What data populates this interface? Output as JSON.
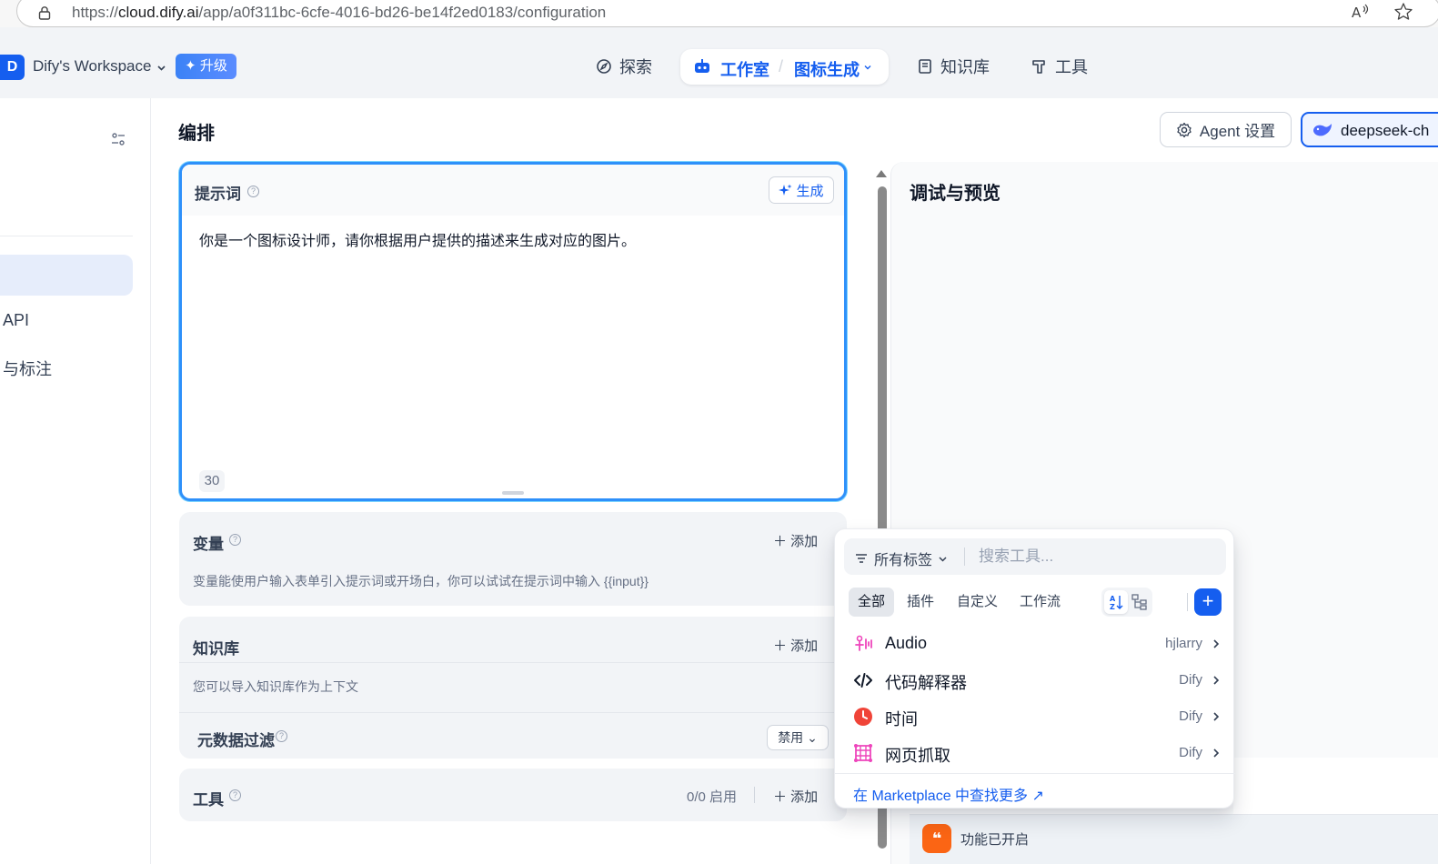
{
  "browser": {
    "url_prefix": "https://",
    "url_host": "cloud.dify.ai",
    "url_path": "/app/a0f311bc-6cfe-4016-bd26-be14f2ed0183/configuration"
  },
  "header": {
    "workspace_initial": "D",
    "workspace_name": "Dify's Workspace",
    "upgrade_label": "✦ 升级",
    "nav": {
      "explore": "探索",
      "studio": "工作室",
      "app_name": "图标生成",
      "knowledge": "知识库",
      "tools": "工具"
    }
  },
  "sidebar": {
    "items": [
      {
        "label": "API"
      },
      {
        "label": "与标注"
      }
    ]
  },
  "main": {
    "title": "编排",
    "agent_settings_label": "Agent 设置",
    "model_label": "deepseek-ch"
  },
  "prompt": {
    "title": "提示词",
    "generate_label": "生成",
    "text": "你是一个图标设计师，请你根据用户提供的描述来生成对应的图片。",
    "char_count": "30"
  },
  "variables": {
    "title": "变量",
    "add_label": "添加",
    "description": "变量能使用户输入表单引入提示词或开场白，你可以试试在提示词中输入 {{input}}"
  },
  "knowledge": {
    "title": "知识库",
    "add_label": "添加",
    "description": "您可以导入知识库作为上下文",
    "metadata_filter_label": "元数据过滤",
    "metadata_filter_value": "禁用"
  },
  "tools": {
    "title": "工具",
    "enabled_count": "0/0 启用",
    "add_label": "添加"
  },
  "debug": {
    "title": "调试与预览",
    "feature_enabled": "功能已开启"
  },
  "tool_popover": {
    "tag_filter_label": "所有标签",
    "search_placeholder": "搜索工具...",
    "tabs": [
      "全部",
      "插件",
      "自定义",
      "工作流"
    ],
    "active_tab": "全部",
    "items": [
      {
        "name": "Audio",
        "author": "hjlarry",
        "icon": "audio-icon"
      },
      {
        "name": "代码解释器",
        "author": "Dify",
        "icon": "code-icon"
      },
      {
        "name": "时间",
        "author": "Dify",
        "icon": "clock-icon"
      },
      {
        "name": "网页抓取",
        "author": "Dify",
        "icon": "web-scraper-icon"
      }
    ],
    "marketplace_label": "在 Marketplace 中查找更多 ↗"
  },
  "colors": {
    "accent": "#155eef",
    "prompt_border": "#2e90fa",
    "feature_icon": "#fb6514"
  }
}
